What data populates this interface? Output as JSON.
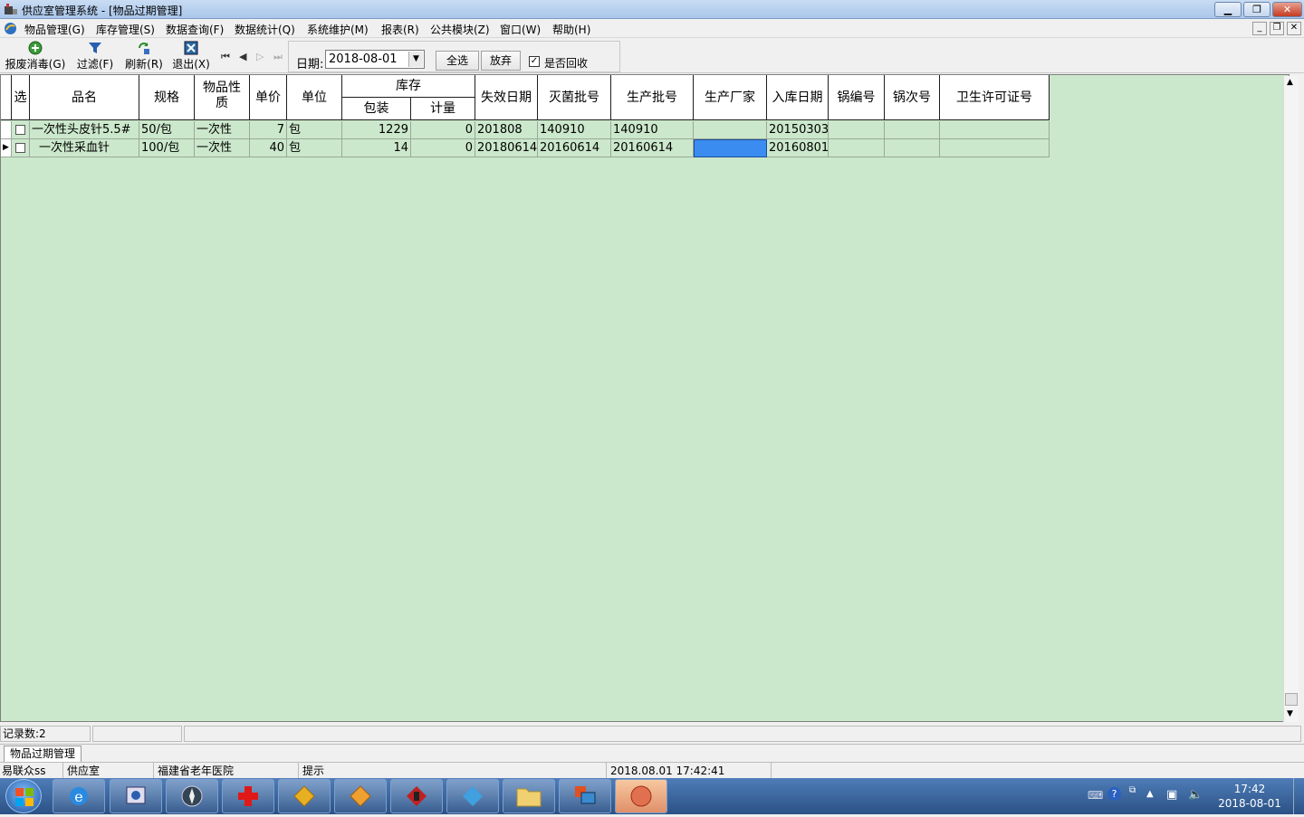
{
  "window": {
    "title": "供应室管理系统 - [物品过期管理]"
  },
  "menu": [
    "物品管理(G)",
    "库存管理(S)",
    "数据查询(F)",
    "数据统计(Q)",
    "系统维护(M)",
    "报表(R)",
    "公共模块(Z)",
    "窗口(W)",
    "帮助(H)"
  ],
  "toolbar": {
    "scrap": "报废消毒(G)",
    "filter": "过滤(F)",
    "refresh": "刷新(R)",
    "exit": "退出(X)"
  },
  "date_filter": {
    "label": "日期:",
    "value": "2018-08-01"
  },
  "buttons": {
    "select_all": "全选",
    "discard": "放弃"
  },
  "recycle": {
    "label": "是否回收",
    "checked": true
  },
  "grid": {
    "headers": {
      "sel": "选",
      "name": "品名",
      "spec": "规格",
      "nature": "物品性质",
      "price": "单价",
      "unit": "单位",
      "stock": "库存",
      "pack": "包装",
      "measure": "计量",
      "expire": "失效日期",
      "steril": "灭菌批号",
      "prod": "生产批号",
      "maker": "生产厂家",
      "indate": "入库日期",
      "pot": "锅编号",
      "potno": "锅次号",
      "license": "卫生许可证号"
    },
    "rows": [
      {
        "name": "一次性头皮针5.5#",
        "spec": "50/包",
        "nature": "一次性",
        "price": "7",
        "unit": "包",
        "pack": "1229",
        "measure": "0",
        "expire": "201808",
        "steril": "140910",
        "prod": "140910",
        "maker": "",
        "indate": "20150303",
        "pot": "",
        "potno": "",
        "license": ""
      },
      {
        "name": "一次性采血针",
        "spec": "100/包",
        "nature": "一次性",
        "price": "40",
        "unit": "包",
        "pack": "14",
        "measure": "0",
        "expire": "20180614",
        "steril": "20160614",
        "prod": "20160614",
        "maker": "",
        "indate": "20160801",
        "pot": "",
        "potno": "",
        "license": ""
      }
    ]
  },
  "status": {
    "records": "记录数:2"
  },
  "tab": {
    "label": "物品过期管理"
  },
  "info": {
    "user": "易联众ss",
    "dept": "供应室",
    "hospital": "福建省老年医院",
    "hint": "提示",
    "datetime": "2018.08.01 17:42:41"
  },
  "clock": {
    "time": "17:42",
    "date": "2018-08-01"
  },
  "colors": {
    "grid_bg": "#cce8cc",
    "selection": "#3b8cf0"
  }
}
